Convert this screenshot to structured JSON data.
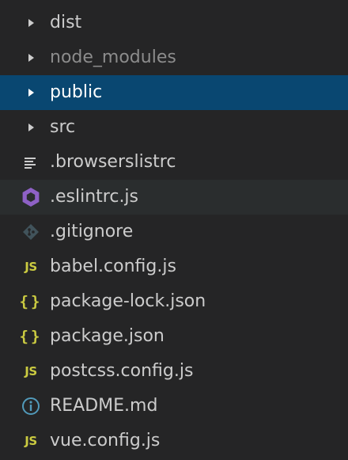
{
  "explorer": {
    "items": [
      {
        "label": "dist",
        "kind": "folder",
        "icon": "chevron-right-icon"
      },
      {
        "label": "node_modules",
        "kind": "folder",
        "icon": "chevron-right-icon"
      },
      {
        "label": "public",
        "kind": "folder",
        "icon": "chevron-right-icon",
        "selected": true
      },
      {
        "label": "src",
        "kind": "folder",
        "icon": "chevron-right-icon"
      },
      {
        "label": ".browserslistrc",
        "kind": "file",
        "icon": "config-lines-icon"
      },
      {
        "label": ".eslintrc.js",
        "kind": "file",
        "icon": "eslint-icon"
      },
      {
        "label": ".gitignore",
        "kind": "file",
        "icon": "git-icon"
      },
      {
        "label": "babel.config.js",
        "kind": "file",
        "icon": "js-icon",
        "icon_text": "JS"
      },
      {
        "label": "package-lock.json",
        "kind": "file",
        "icon": "json-icon",
        "icon_text": "{}"
      },
      {
        "label": "package.json",
        "kind": "file",
        "icon": "json-icon",
        "icon_text": "{}"
      },
      {
        "label": "postcss.config.js",
        "kind": "file",
        "icon": "js-icon",
        "icon_text": "JS"
      },
      {
        "label": "README.md",
        "kind": "file",
        "icon": "info-icon"
      },
      {
        "label": "vue.config.js",
        "kind": "file",
        "icon": "js-icon",
        "icon_text": "JS"
      }
    ]
  },
  "colors": {
    "background": "#252526",
    "selected_row": "#094771",
    "hover_row": "#2a2d2e",
    "text": "#cccccc",
    "dimmed_text": "#8c8c8c",
    "js_yellow": "#cbcb41",
    "eslint_purple": "#8e61c6",
    "info_blue": "#519aba",
    "git_gray": "#41535b"
  }
}
